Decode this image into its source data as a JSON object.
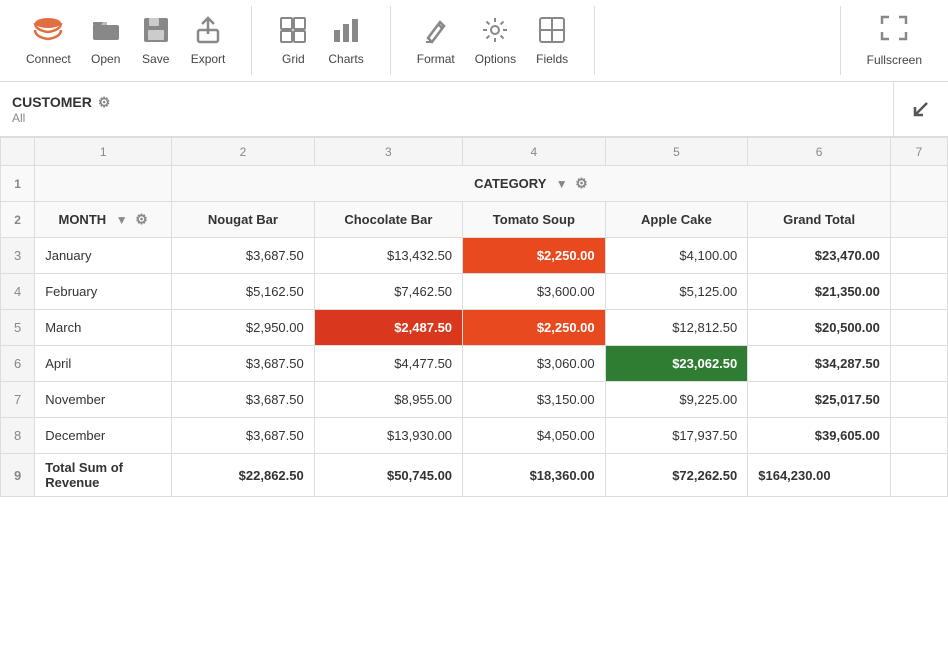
{
  "toolbar": {
    "groups": [
      {
        "buttons": [
          {
            "id": "connect",
            "label": "Connect",
            "icon": "🗄"
          },
          {
            "id": "open",
            "label": "Open",
            "icon": "📂"
          },
          {
            "id": "save",
            "label": "Save",
            "icon": "💾"
          },
          {
            "id": "export",
            "label": "Export",
            "icon": "📤"
          }
        ]
      },
      {
        "buttons": [
          {
            "id": "grid",
            "label": "Grid",
            "icon": "⊞"
          },
          {
            "id": "charts",
            "label": "Charts",
            "icon": "📊"
          }
        ]
      },
      {
        "buttons": [
          {
            "id": "format",
            "label": "Format",
            "icon": "✏️"
          },
          {
            "id": "options",
            "label": "Options",
            "icon": "⚙"
          },
          {
            "id": "fields",
            "label": "Fields",
            "icon": "🔲"
          }
        ]
      }
    ],
    "fullscreen": {
      "label": "Fullscreen",
      "icon": "⤢"
    }
  },
  "customer_bar": {
    "name": "CUSTOMER",
    "sub": "All",
    "gear_icon": "⚙",
    "collapse_icon": "↙"
  },
  "col_numbers": [
    "",
    "1",
    "2",
    "3",
    "4",
    "5",
    "6",
    "7"
  ],
  "table": {
    "category_label": "CATEGORY",
    "month_label": "MONTH",
    "columns": [
      "Nougat Bar",
      "Chocolate Bar",
      "Tomato Soup",
      "Apple Cake",
      "Grand Total"
    ],
    "rows": [
      {
        "row_num": 3,
        "month": "January",
        "values": [
          "$3,687.50",
          "$13,432.50",
          "$2,250.00",
          "$4,100.00"
        ],
        "total": "$23,470.00",
        "highlights": [
          false,
          false,
          "orange",
          false
        ]
      },
      {
        "row_num": 4,
        "month": "February",
        "values": [
          "$5,162.50",
          "$7,462.50",
          "$3,600.00",
          "$5,125.00"
        ],
        "total": "$21,350.00",
        "highlights": [
          false,
          false,
          false,
          false
        ]
      },
      {
        "row_num": 5,
        "month": "March",
        "values": [
          "$2,950.00",
          "$2,487.50",
          "$2,250.00",
          "$12,812.50"
        ],
        "total": "$20,500.00",
        "highlights": [
          false,
          "red",
          "orange",
          false
        ]
      },
      {
        "row_num": 6,
        "month": "April",
        "values": [
          "$3,687.50",
          "$4,477.50",
          "$3,060.00",
          "$23,062.50"
        ],
        "total": "$34,287.50",
        "highlights": [
          false,
          false,
          false,
          "green"
        ]
      },
      {
        "row_num": 7,
        "month": "November",
        "values": [
          "$3,687.50",
          "$8,955.00",
          "$3,150.00",
          "$9,225.00"
        ],
        "total": "$25,017.50",
        "highlights": [
          false,
          false,
          false,
          false
        ]
      },
      {
        "row_num": 8,
        "month": "December",
        "values": [
          "$3,687.50",
          "$13,930.00",
          "$4,050.00",
          "$17,937.50"
        ],
        "total": "$39,605.00",
        "highlights": [
          false,
          false,
          false,
          false
        ]
      }
    ],
    "total_row": {
      "row_num": 9,
      "label": "Total Sum of Revenue",
      "values": [
        "$22,862.50",
        "$50,745.00",
        "$18,360.00",
        "$72,262.50"
      ],
      "total": "$164,230.00"
    }
  }
}
